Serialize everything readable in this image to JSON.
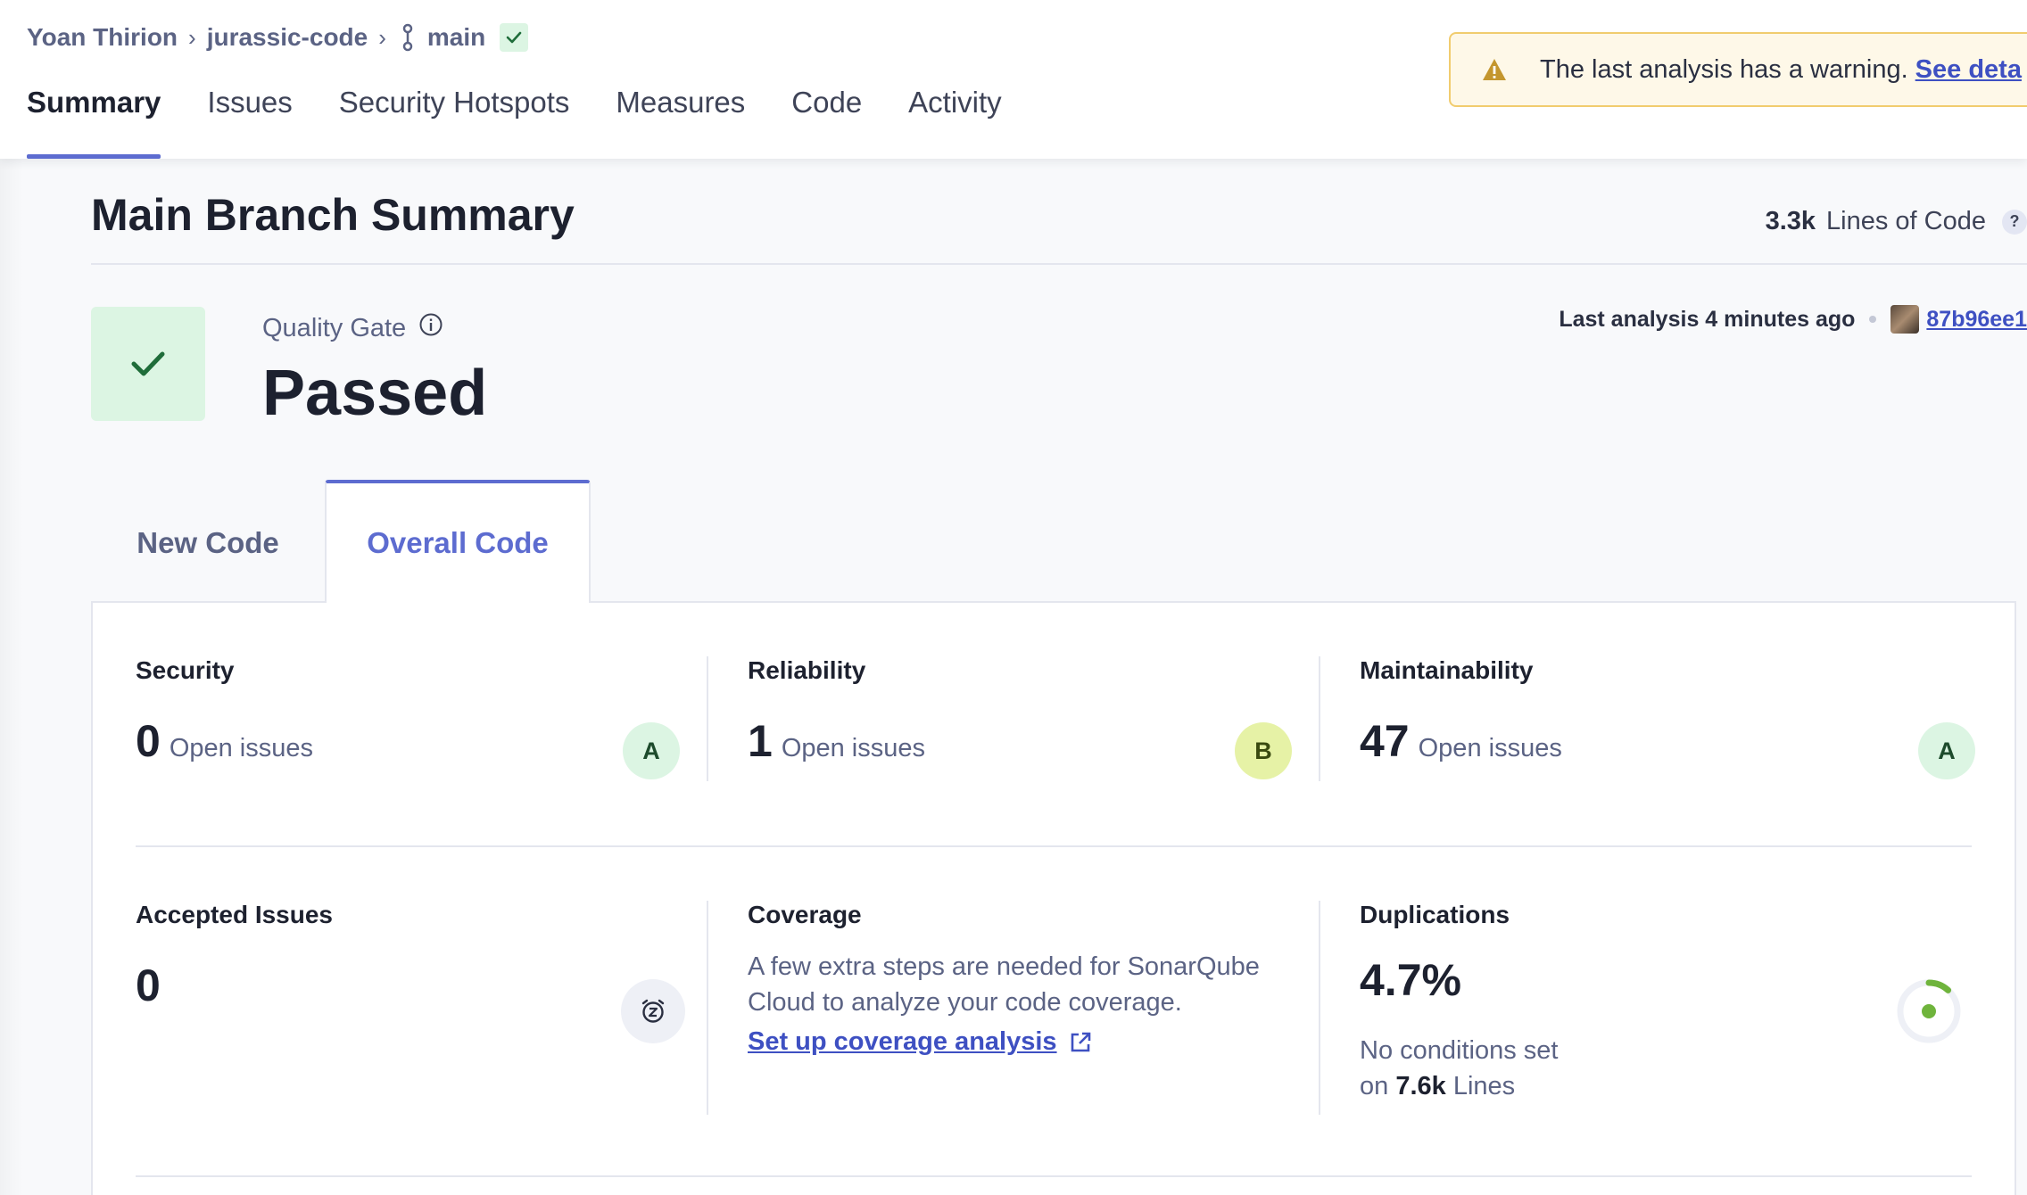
{
  "breadcrumb": {
    "organization": "Yoan Thirion",
    "project": "jurassic-code",
    "branch": "main"
  },
  "nav_tabs": [
    {
      "label": "Summary",
      "active": true
    },
    {
      "label": "Issues",
      "active": false
    },
    {
      "label": "Security Hotspots",
      "active": false
    },
    {
      "label": "Measures",
      "active": false
    },
    {
      "label": "Code",
      "active": false
    },
    {
      "label": "Activity",
      "active": false
    }
  ],
  "warning": {
    "text": "The last analysis has a warning.",
    "link": "See deta"
  },
  "summary": {
    "title": "Main Branch Summary",
    "lines_of_code_value": "3.3k",
    "lines_of_code_label": "Lines of Code",
    "help": "?"
  },
  "quality_gate": {
    "label": "Quality Gate",
    "status": "Passed"
  },
  "last_analysis": {
    "prefix": "Last analysis",
    "when": "4 minutes ago",
    "commit": "87b96ee1"
  },
  "code_tabs": [
    {
      "label": "New Code",
      "active": false
    },
    {
      "label": "Overall Code",
      "active": true
    }
  ],
  "metrics": {
    "security": {
      "title": "Security",
      "value": "0",
      "unit": "Open issues",
      "rating": "A"
    },
    "reliability": {
      "title": "Reliability",
      "value": "1",
      "unit": "Open issues",
      "rating": "B"
    },
    "maintainability": {
      "title": "Maintainability",
      "value": "47",
      "unit": "Open issues",
      "rating": "A"
    },
    "accepted": {
      "title": "Accepted Issues",
      "value": "0"
    },
    "coverage": {
      "title": "Coverage",
      "text": "A few extra steps are needed for SonarQube Cloud to analyze your code coverage.",
      "link": "Set up coverage analysis"
    },
    "duplications": {
      "title": "Duplications",
      "value": "4.7%",
      "percent": 4.7,
      "note_prefix": "No conditions set",
      "note_on": "on",
      "lines_value": "7.6k",
      "lines_label": "Lines"
    }
  },
  "colors": {
    "accent": "#5d6cd0",
    "passed_bg": "#dcf5e3",
    "passed_check": "#1f6d3a",
    "warning_border": "#f1cc6e",
    "warning_icon": "#c4962e",
    "rating_a": "#dcf5e3",
    "rating_b": "#e6f2a6",
    "link": "#3e50c2",
    "donut_fill": "#6fb43c"
  }
}
